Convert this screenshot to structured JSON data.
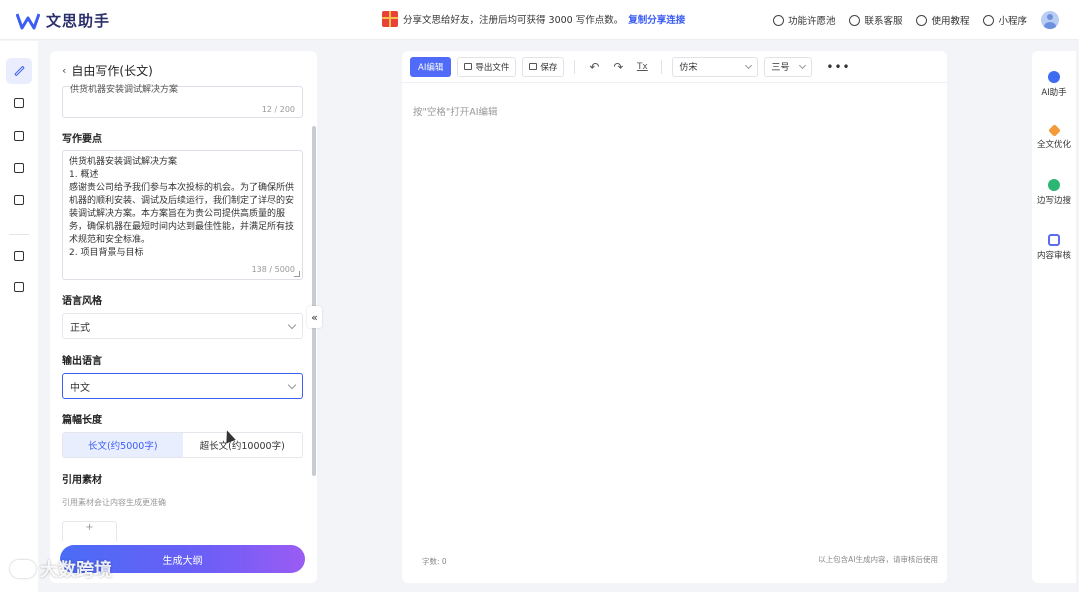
{
  "app": {
    "name": "文思助手"
  },
  "promo": {
    "text": "分享文思给好友，注册后均可获得 3000 写作点数。",
    "link": "复制分享连接"
  },
  "top_links": [
    {
      "label": "功能许愿池",
      "icon": "heart-icon"
    },
    {
      "label": "联系客服",
      "icon": "headset-icon"
    },
    {
      "label": "使用教程",
      "icon": "bulb-icon"
    },
    {
      "label": "小程序",
      "icon": "mini-program-icon"
    }
  ],
  "left_nav": [
    {
      "name": "write",
      "icon": "pen-icon",
      "active": true
    },
    {
      "name": "chat",
      "icon": "chat-icon"
    },
    {
      "name": "template",
      "icon": "template-icon"
    },
    {
      "name": "folder",
      "icon": "folder-icon"
    },
    {
      "name": "document",
      "icon": "document-icon"
    },
    {
      "name": "edit",
      "icon": "edit-icon"
    },
    {
      "name": "check",
      "icon": "check-icon"
    }
  ],
  "panel": {
    "back_icon": "‹",
    "title": "自由写作(长文)",
    "topic_value": "供货机器安装调试解决方案",
    "topic_counter": "12 / 200",
    "points_label": "写作要点",
    "points_lines": [
      "供货机器安装调试解决方案",
      "1. 概述",
      "感谢贵公司给予我们参与本次投标的机会。为了确保所供机器的顺利安装、调试及后续运行，我们制定了详尽的安装调试解决方案。本方案旨在为贵公司提供高质量的服务，确保机器在最短时间内达到最佳性能，并满足所有技术规范和安全标准。",
      "2. 项目背景与目标"
    ],
    "points_counter": "138 / 5000",
    "style_label": "语言风格",
    "style_value": "正式",
    "lang_label": "输出语言",
    "lang_value": "中文",
    "length_label": "篇幅长度",
    "length_options": [
      "长文(约5000字)",
      "超长文(约10000字)"
    ],
    "ref_label": "引用素材",
    "ref_hint": "引用素材会让内容生成更准确",
    "add_label": "+",
    "generate_label": "生成大纲",
    "collapse_label": "«"
  },
  "editor": {
    "toolbar": {
      "ai_label": "AI编辑",
      "export_label": "导出文件",
      "save_label": "保存",
      "font_value": "仿宋",
      "size_value": "三号",
      "more_label": "•••",
      "undo_icon": "↶",
      "redo_icon": "↷",
      "clear_format_icon": "Tx"
    },
    "placeholder": "按\"空格\"打开AI编辑",
    "word_count_label": "字数:  0",
    "footer_note": "以上包含AI生成内容，请审核后使用"
  },
  "right_panel": [
    {
      "label": "AI助手",
      "color": "#3d6cf2"
    },
    {
      "label": "全文优化",
      "color": "#f39a3a"
    },
    {
      "label": "边写边搜",
      "color": "#2bb673"
    },
    {
      "label": "内容审核",
      "color": "#5b6cf0"
    }
  ],
  "watermark": {
    "text": "大数跨境"
  }
}
